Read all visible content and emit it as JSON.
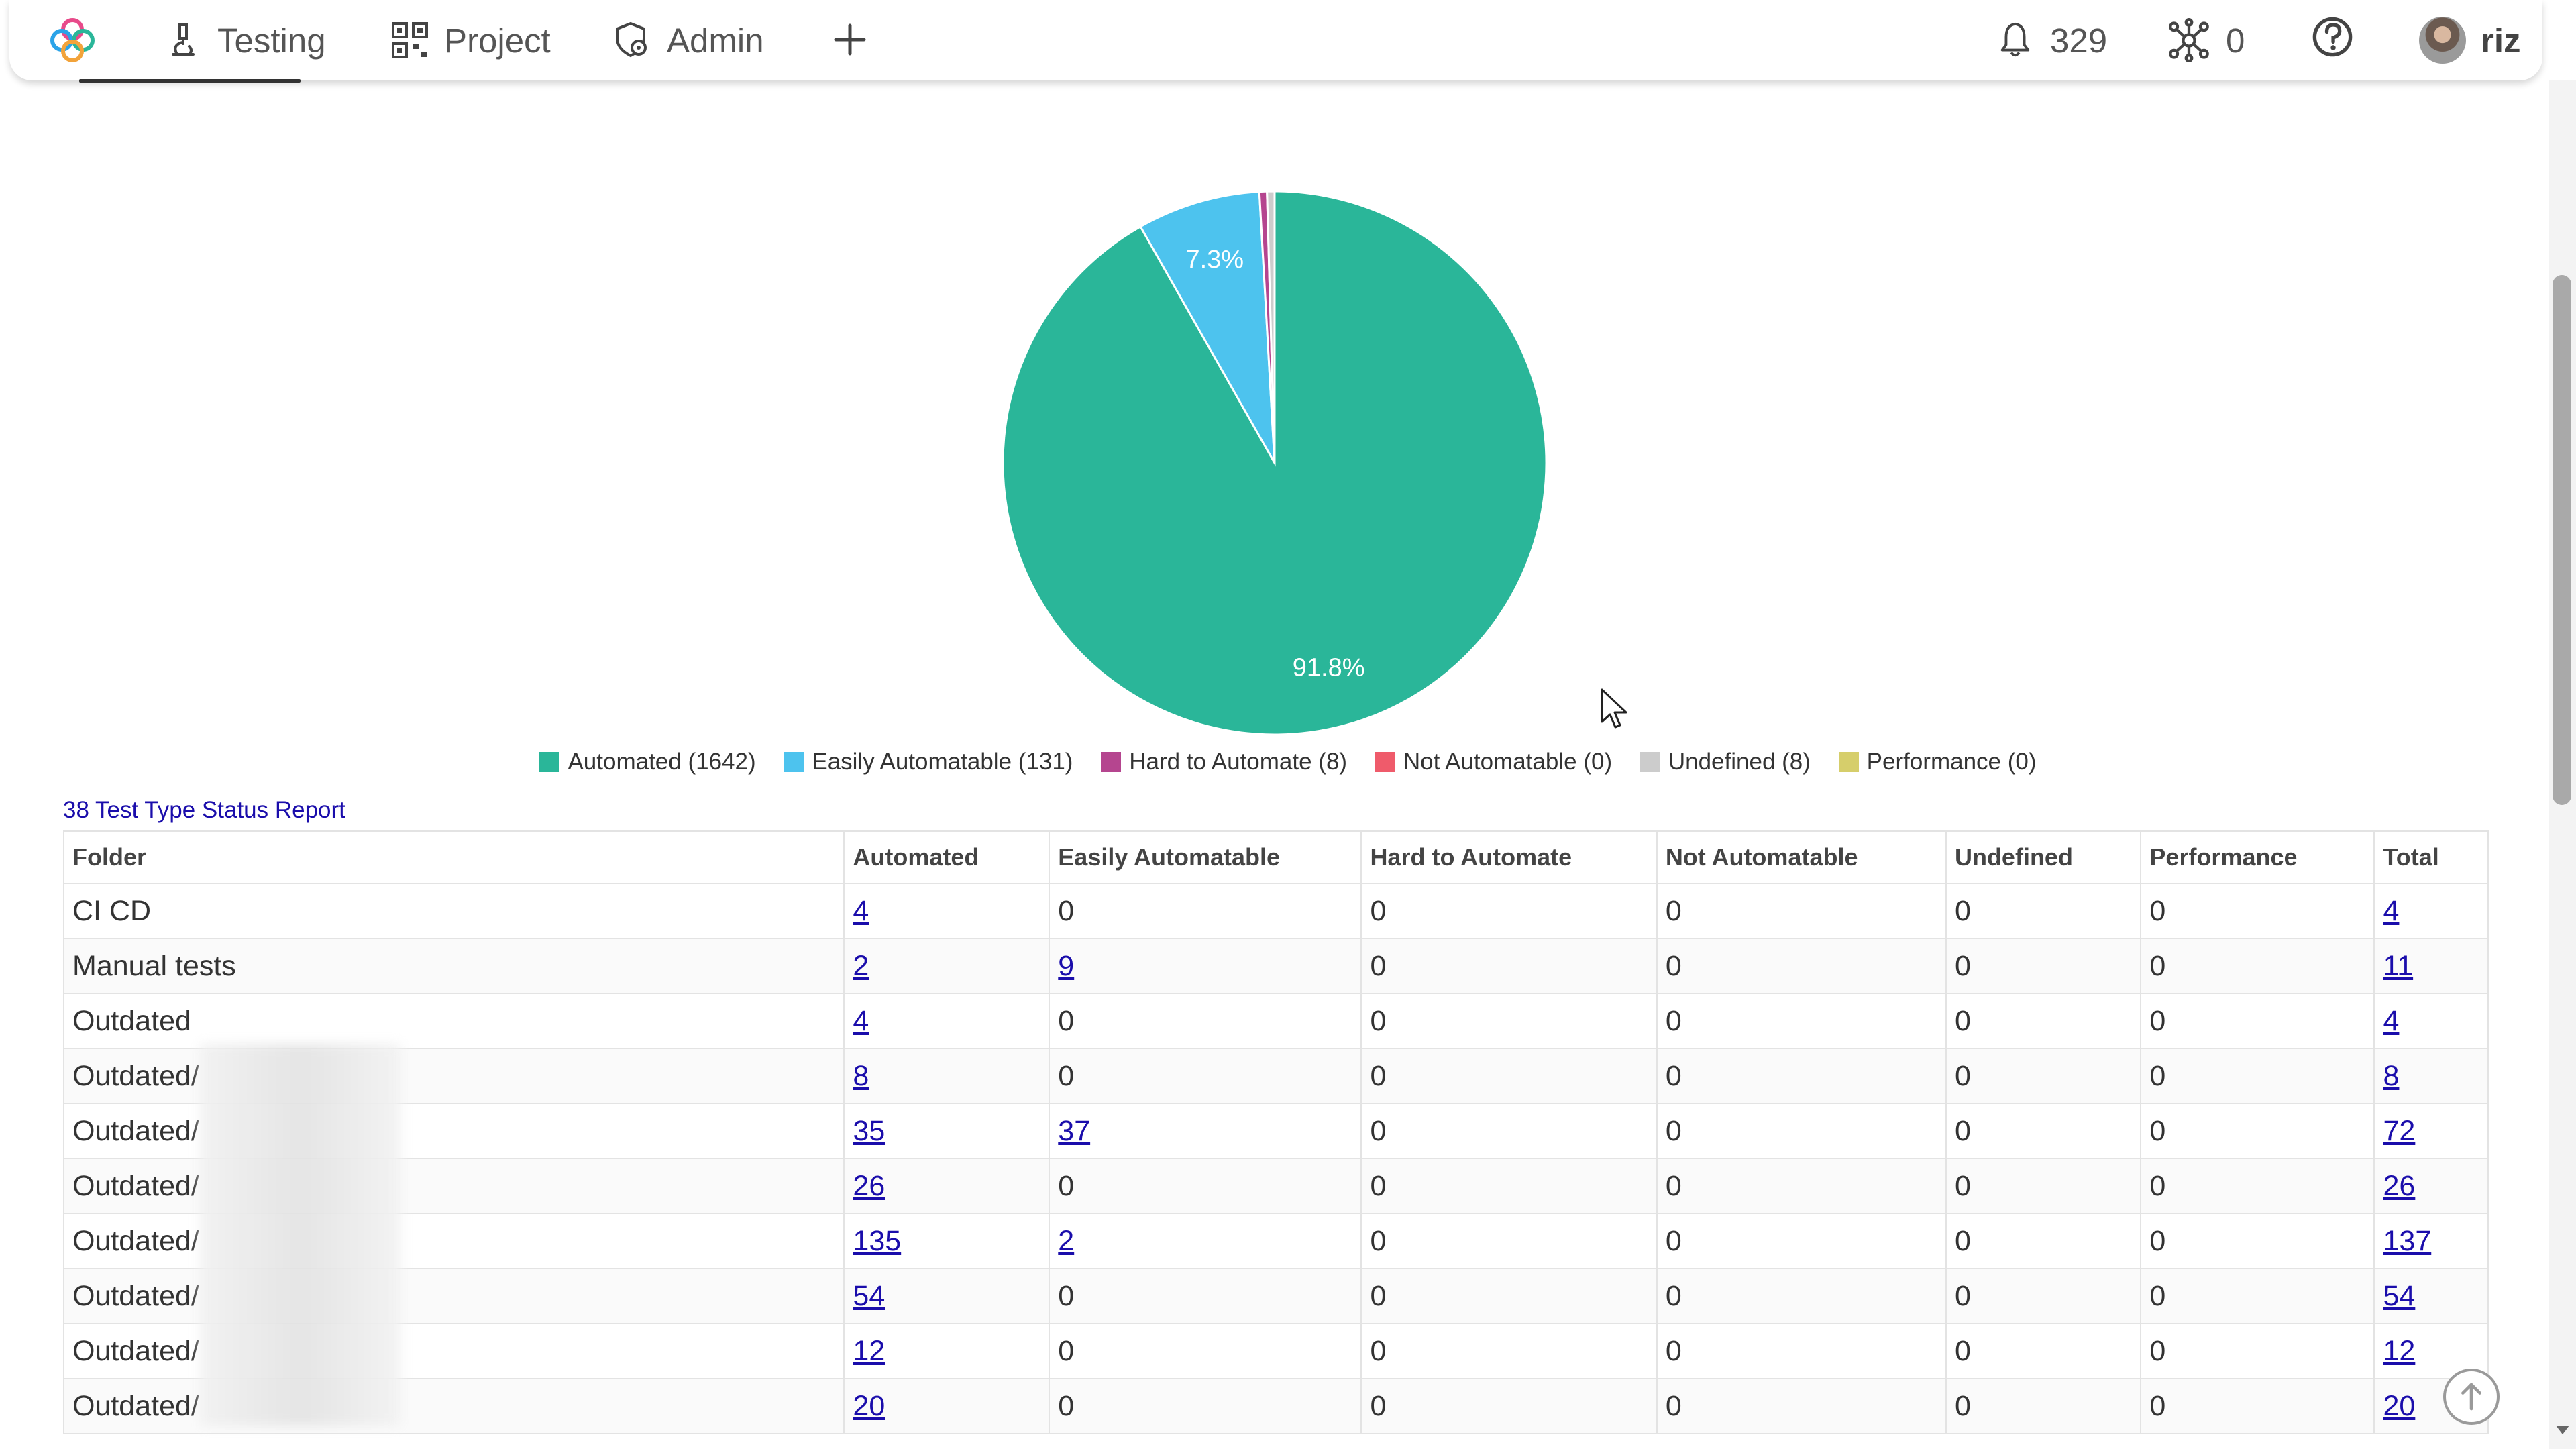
{
  "nav": {
    "items": [
      {
        "label": "Testing",
        "icon": "microscope-icon"
      },
      {
        "label": "Project",
        "icon": "qr-grid-icon"
      },
      {
        "label": "Admin",
        "icon": "shield-gear-icon"
      }
    ],
    "add_icon": "plus-icon",
    "notifications": {
      "icon": "bell-icon",
      "count": "329"
    },
    "integrations": {
      "icon": "network-icon",
      "count": "0"
    },
    "help_icon": "question-icon",
    "user": {
      "name": "riz"
    }
  },
  "colors": {
    "automated": "#2ab699",
    "easily": "#4dc3ee",
    "hard": "#b5458f",
    "not": "#ef5b6b",
    "undefined": "#cccccc",
    "performance": "#d6ce6b"
  },
  "chart_data": {
    "type": "pie",
    "slices": [
      {
        "label": "Automated",
        "value": 1642,
        "color": "#2ab699",
        "pct_label": "91.8%"
      },
      {
        "label": "Easily Automatable",
        "value": 131,
        "color": "#4dc3ee",
        "pct_label": "7.3%"
      },
      {
        "label": "Hard to Automate",
        "value": 8,
        "color": "#b5458f",
        "pct_label": ""
      },
      {
        "label": "Not Automatable",
        "value": 0,
        "color": "#ef5b6b",
        "pct_label": ""
      },
      {
        "label": "Undefined",
        "value": 8,
        "color": "#cccccc",
        "pct_label": ""
      },
      {
        "label": "Performance",
        "value": 0,
        "color": "#d6ce6b",
        "pct_label": ""
      }
    ],
    "legend_position": "bottom"
  },
  "legend": [
    "Automated (1642)",
    "Easily Automatable (131)",
    "Hard to Automate (8)",
    "Not Automatable (0)",
    "Undefined (8)",
    "Performance (0)"
  ],
  "report": {
    "title": "38 Test Type Status Report",
    "columns": [
      "Folder",
      "Automated",
      "Easily Automatable",
      "Hard to Automate",
      "Not Automatable",
      "Undefined",
      "Performance",
      "Total"
    ],
    "rows": [
      [
        "CI CD",
        "4",
        "0",
        "0",
        "0",
        "0",
        "0",
        "4"
      ],
      [
        "Manual tests",
        "2",
        "9",
        "0",
        "0",
        "0",
        "0",
        "11"
      ],
      [
        "Outdated",
        "4",
        "0",
        "0",
        "0",
        "0",
        "0",
        "4"
      ],
      [
        "Outdated/",
        "8",
        "0",
        "0",
        "0",
        "0",
        "0",
        "8"
      ],
      [
        "Outdated/",
        "35",
        "37",
        "0",
        "0",
        "0",
        "0",
        "72"
      ],
      [
        "Outdated/",
        "26",
        "0",
        "0",
        "0",
        "0",
        "0",
        "26"
      ],
      [
        "Outdated/",
        "135",
        "2",
        "0",
        "0",
        "0",
        "0",
        "137"
      ],
      [
        "Outdated/",
        "54",
        "0",
        "0",
        "0",
        "0",
        "0",
        "54"
      ],
      [
        "Outdated/",
        "12",
        "0",
        "0",
        "0",
        "0",
        "0",
        "12"
      ],
      [
        "Outdated/",
        "20",
        "0",
        "0",
        "0",
        "0",
        "0",
        "20"
      ]
    ]
  }
}
